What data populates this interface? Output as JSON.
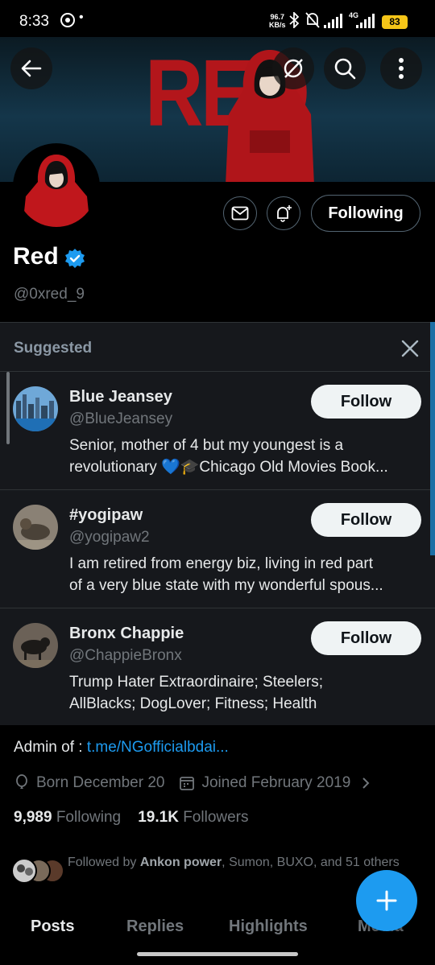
{
  "status_bar": {
    "time": "8:33",
    "bullet": "•",
    "net_speed_value": "96.7",
    "net_speed_unit": "KB/s",
    "network": "4G",
    "battery": "83"
  },
  "header": {
    "banner_text": "RED",
    "back_icon": "arrow-left-icon",
    "actions": [
      "hide-icon",
      "search-icon",
      "more-vertical-icon"
    ]
  },
  "profile": {
    "display_name": "Red",
    "handle": "@0xred_9",
    "following_label": "Following",
    "message_icon": "envelope-icon",
    "notify_icon": "bell-plus-icon",
    "verified_color": "#1d9bf0"
  },
  "suggested": {
    "title": "Suggested",
    "follow_label": "Follow",
    "items": [
      {
        "name": "Blue Jeansey",
        "handle": "@BlueJeansey",
        "bio_line1": "Senior, mother of 4 but my youngest is a",
        "bio_line2": "revolutionary 💙🎓Chicago Old Movies Book..."
      },
      {
        "name": "#yogipaw",
        "handle": "@yogipaw2",
        "bio_line1": "I am retired from energy biz, living in red part",
        "bio_line2": "of a very blue state with my wonderful spous..."
      },
      {
        "name": "Bronx Chappie",
        "handle": "@ChappieBronx",
        "bio_line1": "Trump Hater Extraordinaire; Steelers;",
        "bio_line2": "AllBlacks; DogLover; Fitness; Health"
      }
    ]
  },
  "bio": {
    "admin_prefix": "Admin of : ",
    "admin_link": "t.me/NGofficialbdai...",
    "born": "Born December 20",
    "joined": "Joined February 2019",
    "following_count": "9,989",
    "following_label": "Following",
    "followers_count": "19.1K",
    "followers_label": "Followers",
    "followed_by_prefix": "Followed by ",
    "followed_by_bold": "Ankon power",
    "followed_by_rest": ", Sumon, BUXO, and 51 others"
  },
  "tabs": [
    "Posts",
    "Replies",
    "Highlights",
    "Media"
  ],
  "colors": {
    "accent": "#1d9bf0",
    "background": "#000000",
    "panel": "#16181c",
    "muted_text": "#71767b"
  }
}
